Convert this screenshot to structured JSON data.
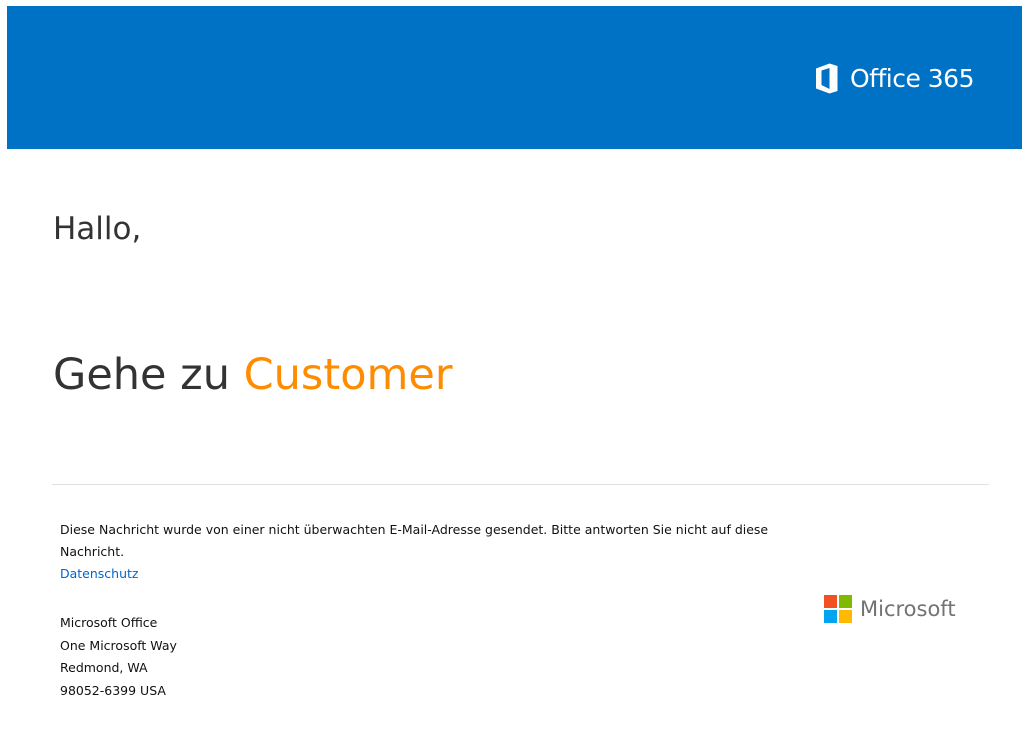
{
  "header": {
    "brand_name": "Office 365",
    "brand_icon": "office-logo-icon",
    "background_color": "#0072c6"
  },
  "main": {
    "greeting": "Hallo,",
    "headline_prefix": "Gehe zu ",
    "headline_accent": "Customer",
    "accent_color": "#ff8c00"
  },
  "footer": {
    "notice": "Diese Nachricht wurde von einer nicht überwachten E-Mail-Adresse gesendet. Bitte antworten Sie nicht auf diese Nachricht.",
    "privacy_link": "Datenschutz",
    "address": {
      "company": "Microsoft Office",
      "street": "One Microsoft Way",
      "city": "Redmond, WA",
      "zip_country": "98052-6399 USA"
    },
    "logo": {
      "name": "Microsoft",
      "icon": "microsoft-logo-icon",
      "colors": [
        "#f25022",
        "#7fba00",
        "#00a4ef",
        "#ffb900"
      ]
    }
  }
}
